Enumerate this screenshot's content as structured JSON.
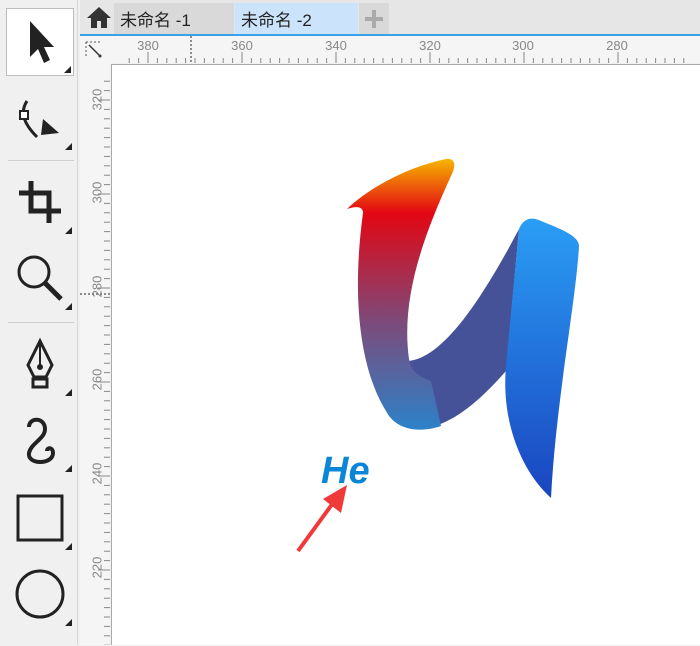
{
  "tabs": [
    {
      "label": "未命名 -1",
      "active": false
    },
    {
      "label": "未命名 -2",
      "active": true
    }
  ],
  "tools": [
    "pick-tool",
    "shape-tool",
    "crop-tool",
    "zoom-tool",
    "pen-tool",
    "curve-tool",
    "rectangle-tool",
    "ellipse-tool"
  ],
  "ruler": {
    "horizontal": [
      "380",
      "360",
      "340",
      "320",
      "300",
      "280"
    ],
    "vertical": [
      "320",
      "300",
      "280",
      "260",
      "240",
      "220"
    ]
  },
  "logo_text": "He",
  "colors": {
    "accent": "#3aa0e8",
    "active_tab": "#cce4fb",
    "arrow": "#f03a3a",
    "logo_text": "#0a86d8"
  }
}
